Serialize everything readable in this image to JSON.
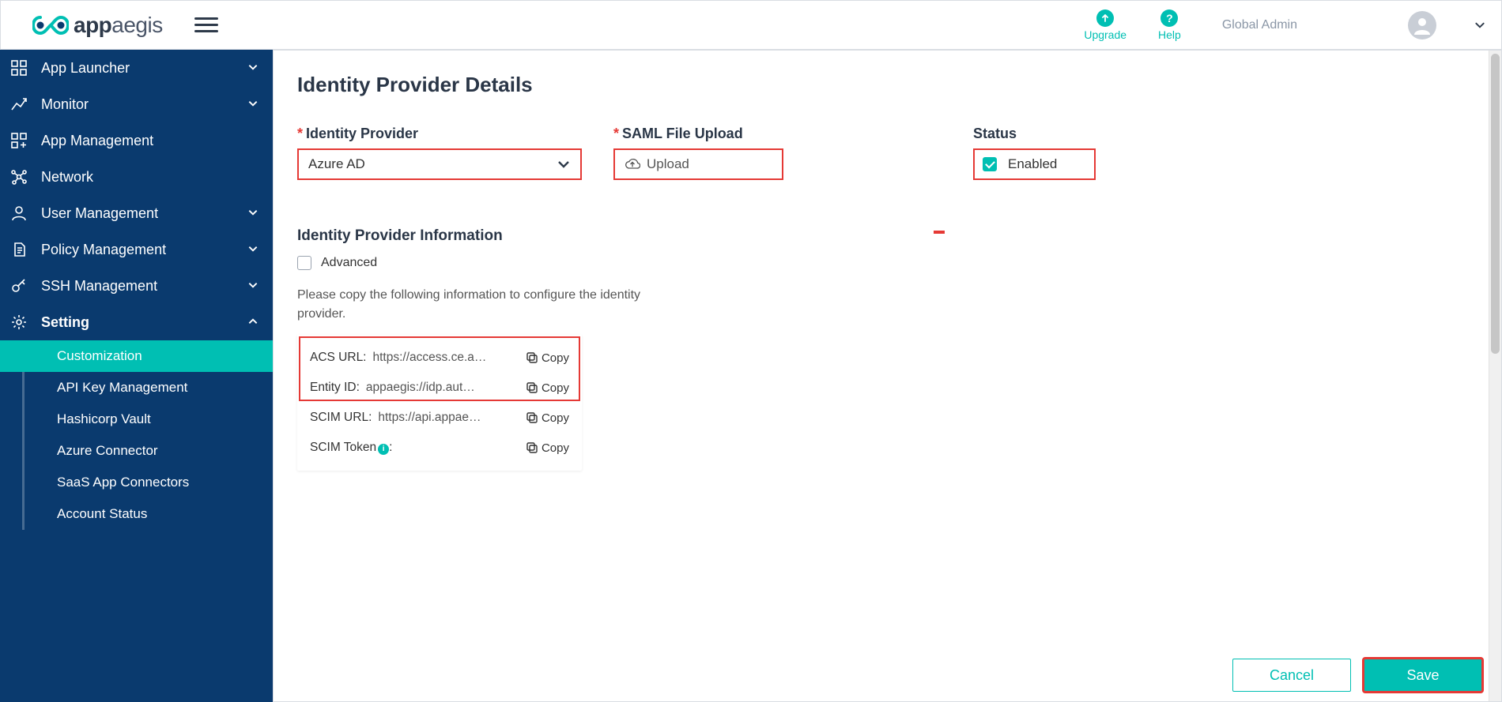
{
  "brand": {
    "name_bold": "app",
    "name_thin": "aegis"
  },
  "topbar": {
    "upgrade": "Upgrade",
    "help": "Help",
    "user_label": "Global Admin"
  },
  "sidebar": {
    "items": [
      {
        "id": "app-launcher",
        "label": "App Launcher",
        "expandable": true
      },
      {
        "id": "monitor",
        "label": "Monitor",
        "expandable": true
      },
      {
        "id": "app-management",
        "label": "App Management",
        "expandable": false
      },
      {
        "id": "network",
        "label": "Network",
        "expandable": false
      },
      {
        "id": "user-management",
        "label": "User Management",
        "expandable": true
      },
      {
        "id": "policy-management",
        "label": "Policy Management",
        "expandable": true
      },
      {
        "id": "ssh-management",
        "label": "SSH Management",
        "expandable": true
      },
      {
        "id": "setting",
        "label": "Setting",
        "expandable": true,
        "expanded": true
      }
    ],
    "setting_children": [
      {
        "id": "customization",
        "label": "Customization",
        "selected": true
      },
      {
        "id": "api-key",
        "label": "API Key Management"
      },
      {
        "id": "hashicorp",
        "label": "Hashicorp Vault"
      },
      {
        "id": "azure-connector",
        "label": "Azure Connector"
      },
      {
        "id": "saas-connectors",
        "label": "SaaS App Connectors"
      },
      {
        "id": "account-status",
        "label": "Account Status"
      }
    ]
  },
  "page": {
    "title": "Identity Provider Details",
    "form": {
      "idp_label": "Identity Provider",
      "idp_value": "Azure AD",
      "saml_label": "SAML File Upload",
      "upload_label": "Upload",
      "status_label": "Status",
      "status_value": "Enabled",
      "status_checked": true
    },
    "info": {
      "section_title": "Identity Provider Information",
      "advanced_label": "Advanced",
      "advanced_checked": false,
      "help_text": "Please copy the following information to configure the identity provider.",
      "rows": [
        {
          "label": "ACS URL:",
          "value": "https://access.ce.a…",
          "highlight": true
        },
        {
          "label": "Entity ID:",
          "value": "appaegis://idp.aut…",
          "highlight": true
        },
        {
          "label": "SCIM URL:",
          "value": "https://api.appae…",
          "highlight": false
        },
        {
          "label": "SCIM Token",
          "value": "",
          "info_icon": true,
          "colon": ":",
          "highlight": false
        }
      ],
      "copy_label": "Copy"
    },
    "actions": {
      "cancel": "Cancel",
      "save": "Save"
    }
  }
}
